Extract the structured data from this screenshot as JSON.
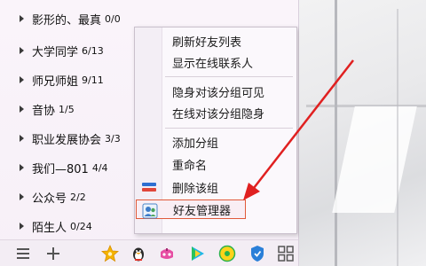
{
  "groups": [
    {
      "name": "影形的、最真",
      "count": "0/0"
    },
    {
      "name": "大学同学",
      "count": "6/13"
    },
    {
      "name": "师兄师姐",
      "count": "9/11"
    },
    {
      "name": "音协",
      "count": "1/5"
    },
    {
      "name": "职业发展协会",
      "count": "3/3"
    },
    {
      "name": "我们—801",
      "count": "4/4"
    },
    {
      "name": "公众号",
      "count": "2/2"
    },
    {
      "name": "陌生人",
      "count": "0/24"
    }
  ],
  "context_menu": {
    "refresh_friend_list": "刷新好友列表",
    "show_online_contacts": "显示在线联系人",
    "invisible_visible_to_group": "隐身对该分组可见",
    "online_invisible_to_group": "在线对该分组隐身",
    "add_group": "添加分组",
    "rename": "重命名",
    "delete_group": "删除该组",
    "friend_manager": "好友管理器"
  },
  "toolbar": {
    "icons": [
      "menu-icon",
      "add-icon",
      "qzone-icon",
      "penguin-icon",
      "game-icon",
      "video-icon",
      "music-icon",
      "security-icon",
      "apps-grid-icon"
    ]
  },
  "colors": {
    "highlight_border": "#e05a3a",
    "annotation_arrow": "#e02020",
    "panel_bg": "#f7f0f8"
  }
}
